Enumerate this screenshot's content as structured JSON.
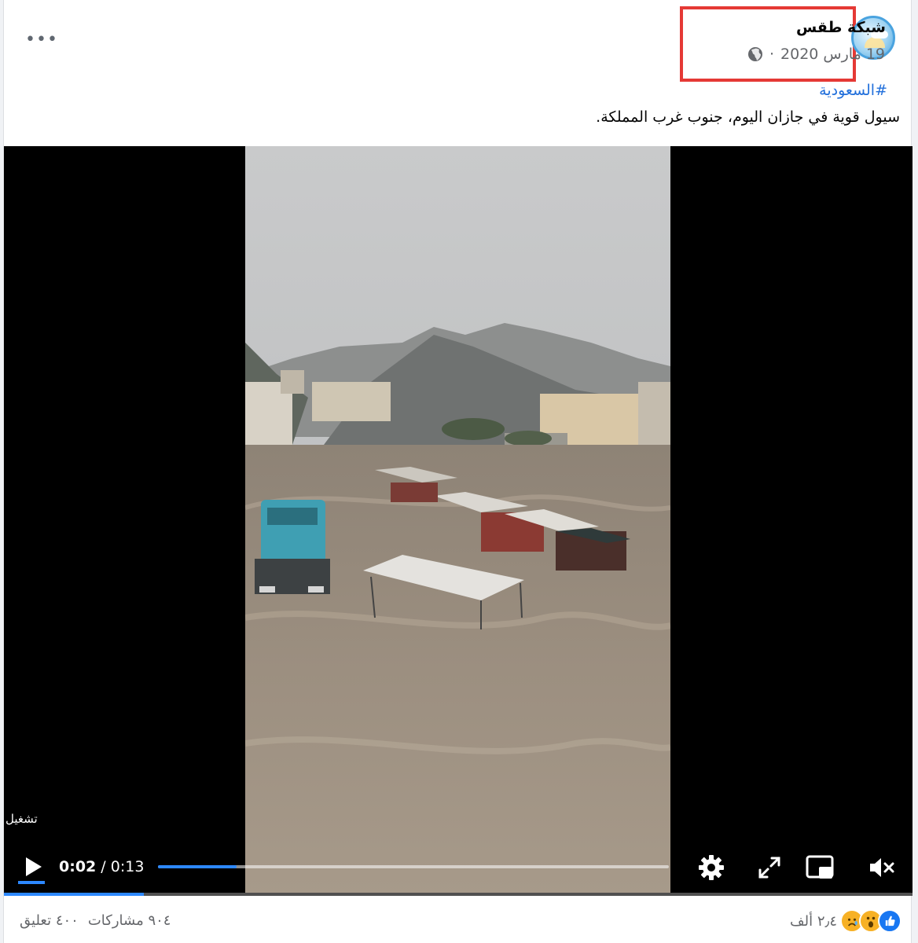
{
  "post": {
    "page_name": "شبكة طقس",
    "date": "19 مارس 2020",
    "separator": "·",
    "audience_icon": "globe-icon",
    "more_icon": "more-options-icon",
    "more_label": "•••",
    "hashtag": "#السعودية",
    "caption": "سيول قوية في جازان اليوم، جنوب غرب المملكة."
  },
  "video": {
    "overlay_label": "تشغيل",
    "current_time": "0:02",
    "time_separator": " / ",
    "duration": "0:13",
    "progress_fraction": 0.154,
    "controls": [
      "play-icon",
      "settings-icon",
      "fullscreen-icon",
      "picture-in-picture-icon",
      "muted-volume-icon"
    ],
    "accent_color": "#2d88ff"
  },
  "footer": {
    "reaction_icons": [
      "like-icon",
      "wow-icon",
      "sad-icon"
    ],
    "reaction_count": "٢٫٤ ألف",
    "comments": "٤٠٠ تعليق",
    "shares": "٩٠٤ مشاركات"
  },
  "colors": {
    "highlight_box": "#e53935",
    "link": "#216fdb",
    "secondary_text": "#65676b"
  }
}
